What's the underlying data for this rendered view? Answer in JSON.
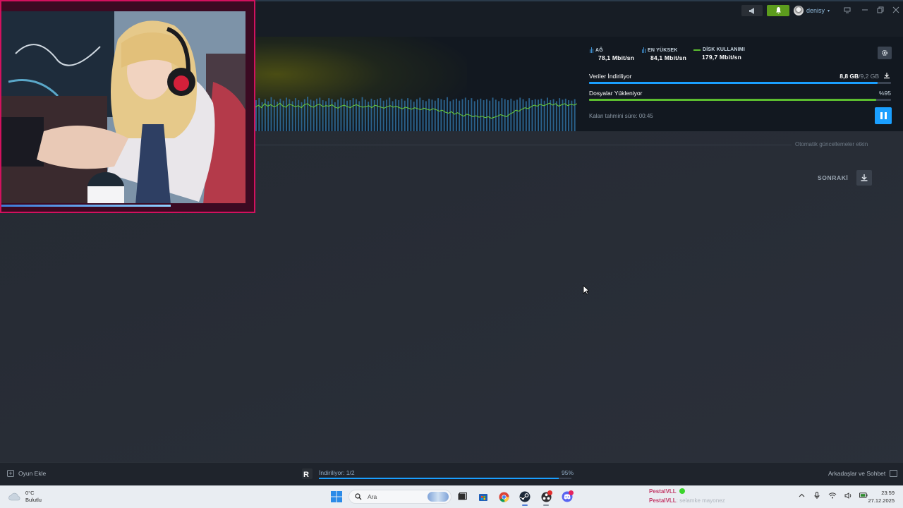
{
  "topbar": {
    "username": "denisy",
    "icons": [
      "megaphone-icon",
      "bell-icon",
      "monitor-icon",
      "minimize-icon",
      "restore-icon",
      "close-icon"
    ]
  },
  "stats": {
    "network": {
      "label": "AĞ",
      "value": "78,1 Mbit/sn"
    },
    "peak": {
      "label": "EN YÜKSEK",
      "value": "84,1 Mbit/sn"
    },
    "disk": {
      "label": "DİSK KULLANIMI",
      "value": "179,7 Mbit/sn"
    }
  },
  "download": {
    "data_label": "Veriler İndiriliyor",
    "data_done": "8,8 GB",
    "data_total": "/9,2 GB",
    "data_progress": 0.956,
    "files_label": "Dosyalar Yükleniyor",
    "files_pct": "%95",
    "files_progress": 0.95,
    "eta": "Kalan tahmini süre: 00:45",
    "auto_updates": "Otomatik güncellemeler etkin",
    "next_label": "SONRAKİ"
  },
  "graph": {
    "network_bars": [
      62,
      66,
      58,
      64,
      60,
      68,
      63,
      59,
      65,
      61,
      67,
      64,
      60,
      66,
      62,
      58,
      64,
      69,
      63,
      61,
      65,
      67,
      62,
      60,
      66,
      64,
      58,
      63,
      67,
      65,
      61,
      62,
      66,
      64,
      60,
      68,
      63,
      59,
      65,
      62,
      64,
      66,
      61,
      63,
      67,
      60,
      64,
      62,
      65,
      61,
      66,
      63,
      59,
      64,
      67,
      62,
      60,
      65,
      63,
      61,
      66,
      64,
      62,
      68,
      60,
      63,
      65,
      61,
      64,
      67,
      62,
      66,
      60,
      63,
      65,
      62,
      64,
      61,
      67,
      63,
      60,
      66,
      64,
      62,
      65,
      61,
      63,
      67,
      64,
      60,
      66,
      62,
      64,
      63,
      65,
      61,
      67,
      62,
      64,
      60,
      66,
      63,
      65,
      62,
      61,
      64
    ],
    "disk_line": [
      48,
      52,
      47,
      55,
      50,
      53,
      49,
      51,
      56,
      50,
      48,
      54,
      52,
      49,
      51,
      47,
      53,
      55,
      50,
      48,
      52,
      54,
      49,
      51,
      50,
      53,
      48,
      46,
      50,
      52,
      49,
      47,
      51,
      53,
      50,
      48,
      49,
      51,
      47,
      52,
      50,
      48,
      46,
      49,
      51,
      48,
      50,
      47,
      45,
      48,
      46,
      44,
      47,
      45,
      43,
      46,
      44,
      42,
      45,
      43,
      40,
      42,
      38,
      36,
      39,
      34,
      37,
      33,
      30,
      34,
      32,
      29,
      31,
      28,
      30,
      27,
      29,
      26,
      28,
      30,
      33,
      31,
      29,
      34,
      37,
      42,
      40,
      44,
      47,
      45,
      49,
      52,
      50,
      54,
      51,
      53,
      56,
      52,
      55,
      50,
      53,
      55,
      51,
      54,
      52,
      55
    ],
    "y_max": 100
  },
  "bottombar": {
    "add_game": "Oyun Ekle",
    "downloading": "İndiriliyor: 1/2",
    "dl_pct": "95%",
    "dl_progress": 0.95,
    "friends": "Arkadaşlar ve Sohbet"
  },
  "taskbar": {
    "weather_temp": "0°C",
    "weather_desc": "Bulutlu",
    "search_placeholder": "Ara",
    "stream_name_1": "PestalVLL",
    "stream_name_2": "PestalVLL",
    "stream_msg": ": selamke mayonez",
    "time": "23:59",
    "date": "27.12.2025"
  },
  "colors": {
    "accent_blue": "#1a9fff",
    "progress_green": "#5cbd2f",
    "net_bar_blue": "#3e8fcf",
    "notif_green": "#5c9c1d",
    "webcam_border": "#d2115e"
  }
}
